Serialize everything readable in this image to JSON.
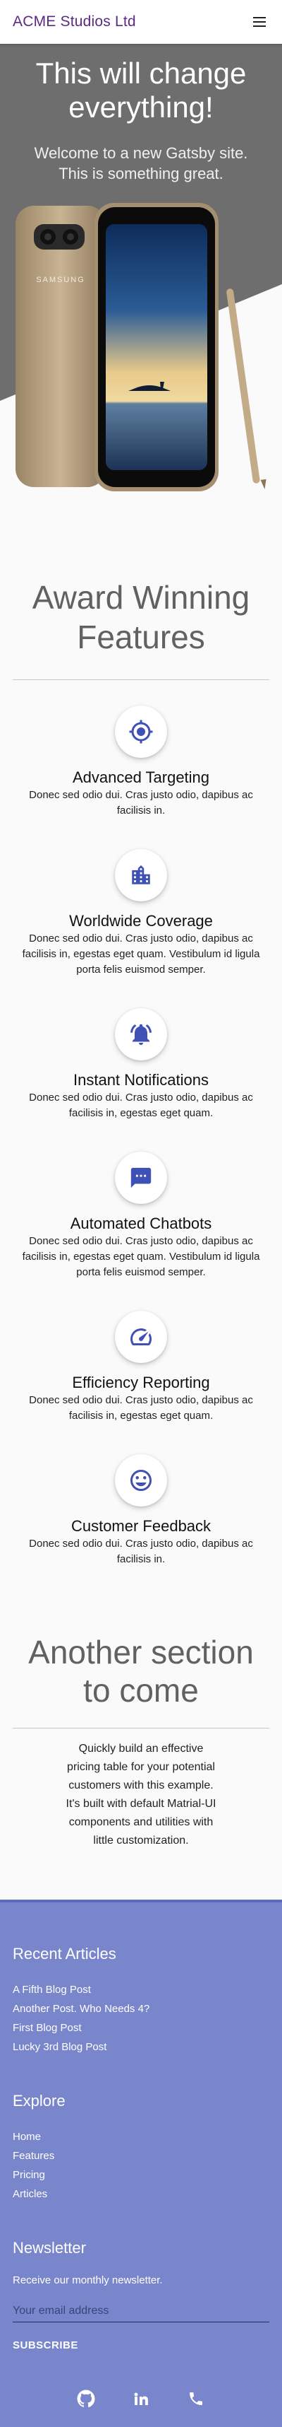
{
  "header": {
    "brand": "ACME Studios Ltd",
    "menu_icon": "menu-icon"
  },
  "hero": {
    "title": "This will change everything!",
    "subtitle": "Welcome to a new Gatsby site. This is something great.",
    "phone_brand": "SAMSUNG"
  },
  "features": {
    "title": "Award Winning Features",
    "items": [
      {
        "icon": "target-icon",
        "title": "Advanced Targeting",
        "desc": "Donec sed odio dui. Cras justo odio, dapibus ac facilisis in."
      },
      {
        "icon": "building-icon",
        "title": "Worldwide Coverage",
        "desc": "Donec sed odio dui. Cras justo odio, dapibus ac facilisis in, egestas eget quam. Vestibulum id ligula porta felis euismod semper."
      },
      {
        "icon": "bell-icon",
        "title": "Instant Notifications",
        "desc": "Donec sed odio dui. Cras justo odio, dapibus ac facilisis in, egestas eget quam."
      },
      {
        "icon": "chat-icon",
        "title": "Automated Chatbots",
        "desc": "Donec sed odio dui. Cras justo odio, dapibus ac facilisis in, egestas eget quam. Vestibulum id ligula porta felis euismod semper."
      },
      {
        "icon": "speedometer-icon",
        "title": "Efficiency Reporting",
        "desc": "Donec sed odio dui. Cras justo odio, dapibus ac facilisis in, egestas eget quam."
      },
      {
        "icon": "smiley-icon",
        "title": "Customer Feedback",
        "desc": "Donec sed odio dui. Cras justo odio, dapibus ac facilisis in."
      }
    ]
  },
  "another": {
    "title": "Another section to come",
    "text": "Quickly build an effective pricing table for your potential customers with this example. It's built with default Matrial-UI components and utilities with little customization."
  },
  "footer": {
    "recent_title": "Recent Articles",
    "recent": [
      "A Fifth Blog Post",
      "Another Post. Who Needs 4?",
      "First Blog Post",
      "Lucky 3rd Blog Post"
    ],
    "explore_title": "Explore",
    "explore": [
      "Home",
      "Features",
      "Pricing",
      "Articles"
    ],
    "newsletter_title": "Newsletter",
    "newsletter_text": "Receive our monthly newsletter.",
    "email_placeholder": "Your email address",
    "subscribe": "SUBSCRIBE",
    "social_icons": [
      "github-icon",
      "linkedin-icon",
      "phone-icon"
    ]
  },
  "colors": {
    "brand": "#5b2a86",
    "hero_grey": "#6e6e6e",
    "accent": "#3f51b5",
    "footer_bg": "#7986cb"
  }
}
